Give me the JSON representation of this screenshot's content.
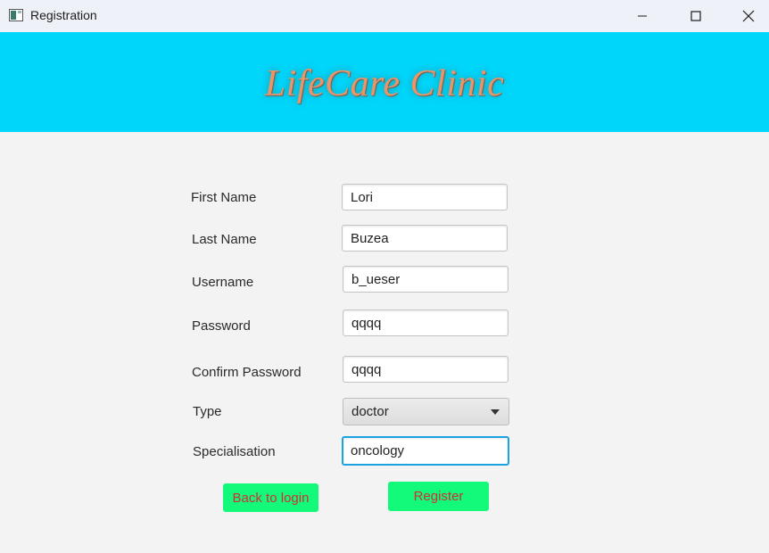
{
  "window": {
    "title": "Registration",
    "icons": {
      "app": "app-window-icon",
      "minimize": "minimize-icon",
      "maximize": "maximize-icon",
      "close": "close-icon"
    }
  },
  "header": {
    "brand": "LifeCare Clinic",
    "colors": {
      "background": "#00d5fa",
      "brand_text": "#e8956a"
    }
  },
  "form": {
    "first_name": {
      "label": "First Name",
      "value": "Lori"
    },
    "last_name": {
      "label": "Last Name",
      "value": "Buzea"
    },
    "username": {
      "label": "Username",
      "value": "b_ueser"
    },
    "password": {
      "label": "Password",
      "value": "qqqq"
    },
    "confirm_password": {
      "label": "Confirm Password",
      "value": "qqqq"
    },
    "type": {
      "label": "Type",
      "value": "doctor",
      "icon": "chevron-down-icon"
    },
    "specialisation": {
      "label": "Specialisation",
      "value": "oncology"
    }
  },
  "buttons": {
    "back": "Back to login",
    "register": "Register",
    "colors": {
      "background": "#13fa7a",
      "text": "#d42c3a"
    }
  }
}
